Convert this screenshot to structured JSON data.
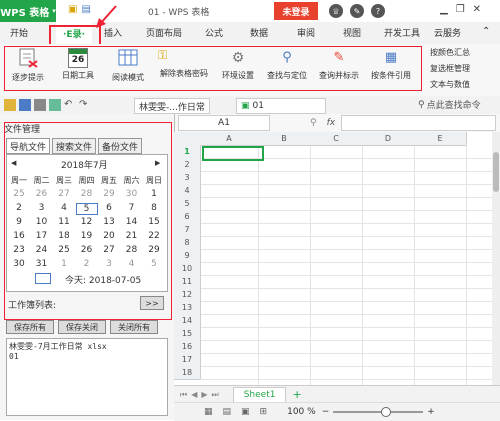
{
  "titlebar": {
    "app_name": "WPS 表格",
    "doc_tab": "01 - WPS 表格",
    "login_button": "未登录",
    "icons": [
      "shirt-icon",
      "wrench-icon",
      "help-icon",
      "minimize-icon",
      "restore-icon",
      "close-icon"
    ]
  },
  "menubar": {
    "items": [
      "开始",
      "·E录·",
      "插入",
      "页面布局",
      "公式",
      "数据",
      "审阅",
      "视图",
      "开发工具",
      "云服务"
    ]
  },
  "ribbon": {
    "buttons": [
      "逐步提示",
      "日期工具",
      "阅读模式",
      "解除表格密码",
      "环境设置",
      "查找与定位",
      "查询并标示",
      "按条件引用"
    ],
    "date_number": "26",
    "side_items": [
      "按颜色汇总",
      "复选框管理",
      "文本与数值"
    ]
  },
  "quick_access": {
    "tabs": [
      "林雯雯-...作日常",
      "01"
    ],
    "search_placeholder": "点此查找命令"
  },
  "formula_bar": {
    "cell_ref": "A1",
    "fx_label": "fx"
  },
  "left_panel": {
    "title": "文件管理",
    "tabs": [
      "导航文件",
      "搜索文件",
      "备份文件"
    ],
    "month_label": "2018年7月",
    "weekdays": [
      "周一",
      "周二",
      "周三",
      "周四",
      "周五",
      "周六",
      "周日"
    ],
    "days": [
      [
        "25",
        "26",
        "27",
        "28",
        "29",
        "30",
        "1"
      ],
      [
        "2",
        "3",
        "4",
        "5",
        "6",
        "7",
        "8"
      ],
      [
        "9",
        "10",
        "11",
        "12",
        "13",
        "14",
        "15"
      ],
      [
        "16",
        "17",
        "18",
        "19",
        "20",
        "21",
        "22"
      ],
      [
        "23",
        "24",
        "25",
        "26",
        "27",
        "28",
        "29"
      ],
      [
        "30",
        "31",
        "1",
        "2",
        "3",
        "4",
        "5"
      ]
    ],
    "today_label": "今天: 2018-07-05",
    "worklist_label": "工作簿列表:",
    "expand_button": ">>",
    "buttons": [
      "保存所有",
      "保存关闭",
      "关闭所有"
    ],
    "note_lines": [
      "林雯雯-7月工作日常 xlsx",
      "01"
    ]
  },
  "grid": {
    "columns": [
      "A",
      "B",
      "C",
      "D",
      "E"
    ],
    "rows": [
      "1",
      "2",
      "3",
      "4",
      "5",
      "6",
      "7",
      "8",
      "9",
      "10",
      "11",
      "12",
      "13",
      "14",
      "15",
      "16",
      "17",
      "18"
    ]
  },
  "sheet_tabs": [
    "Sheet1"
  ],
  "statusbar": {
    "zoom": "100 %"
  },
  "colors": {
    "brand_green": "#22a548",
    "login_red": "#e8422e",
    "highlight_red": "#e23"
  }
}
